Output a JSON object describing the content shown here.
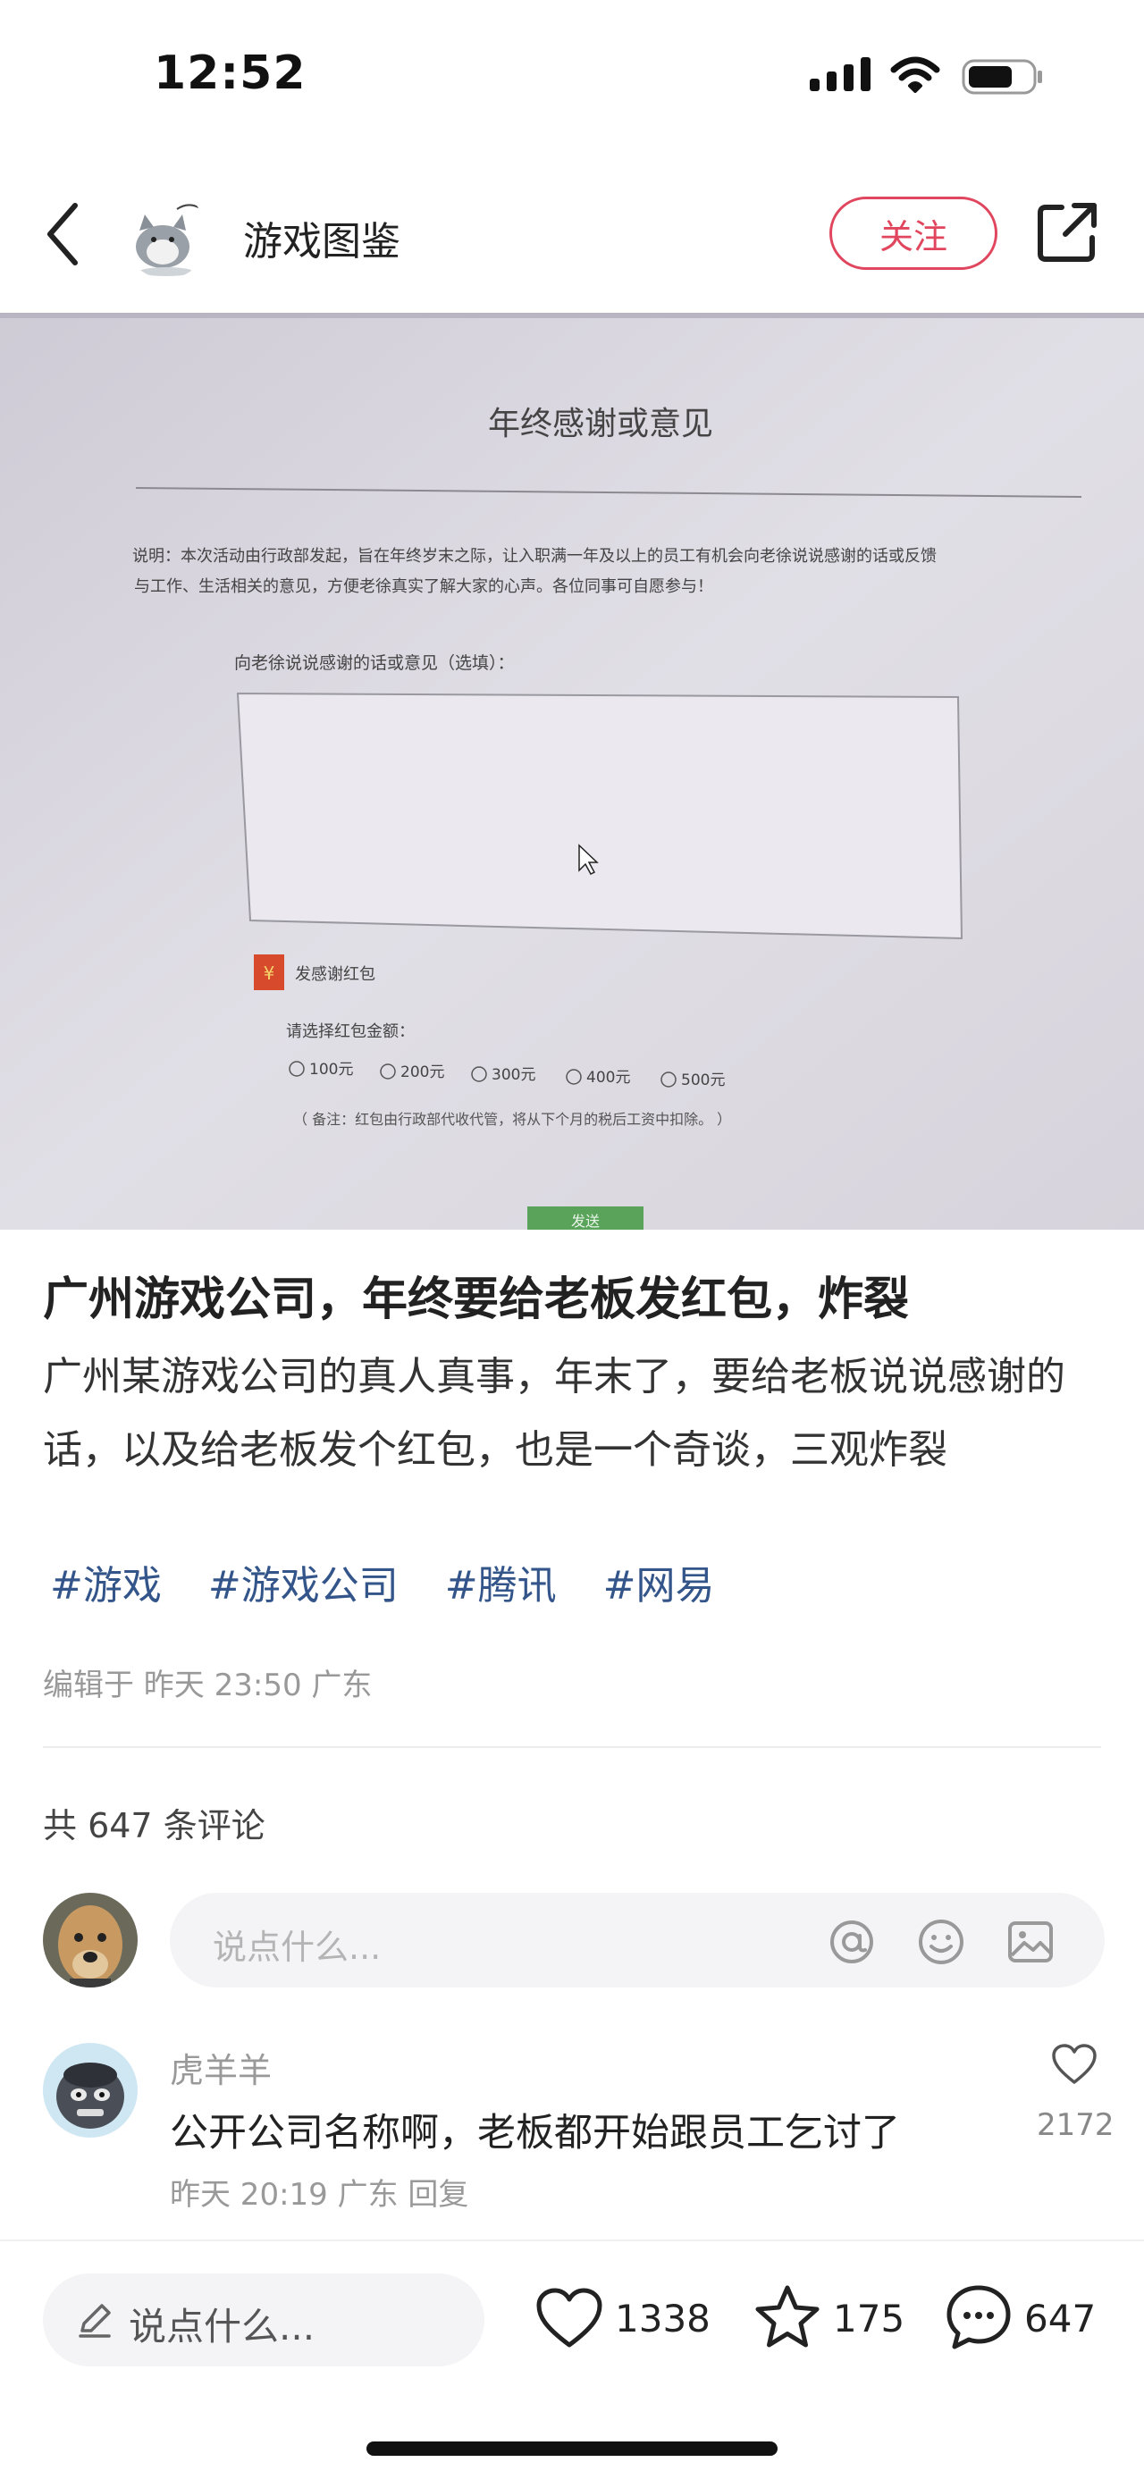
{
  "status": {
    "time": "12:52"
  },
  "nav": {
    "author": "游戏图鉴",
    "follow_label": "关注"
  },
  "photo": {
    "form_title": "年终感谢或意见",
    "desc_line1": "说明：本次活动由行政部发起，旨在年终岁末之际，让入职满一年及以上的员工有机会向老徐说说感谢的话或反馈",
    "desc_line2": "与工作、生活相关的意见，方便老徐真实了解大家的心声。各位同事可自愿参与！",
    "prompt": "向老徐说说感谢的话或意见（选填）：",
    "hongbao_icon": "¥",
    "hongbao_label": "发感谢红包",
    "amount_label": "请选择红包金额：",
    "amounts": [
      "100元",
      "200元",
      "300元",
      "400元",
      "500元"
    ],
    "note": "（ 备注：红包由行政部代收代管，将从下个月的税后工资中扣除。 ）",
    "send_label": "发送"
  },
  "post": {
    "title": "广州游戏公司，年终要给老板发红包，炸裂",
    "body": "广州某游戏公司的真人真事，年末了，要给老板说说感谢的话，以及给老板发个红包，也是一个奇谈，三观炸裂",
    "tags": [
      "#游戏",
      "#游戏公司",
      "#腾讯",
      "#网易"
    ],
    "edit_info": "编辑于 昨天 23:50 广东"
  },
  "comments": {
    "count_text": "共 647 条评论",
    "input_placeholder": "说点什么...",
    "items": [
      {
        "user": "虎羊羊",
        "text": "公开公司名称啊，老板都开始跟员工乞讨了",
        "meta": "昨天 20:19 广东 回复",
        "likes": "2172"
      }
    ]
  },
  "bottom_bar": {
    "placeholder": "说点什么...",
    "likes": "1338",
    "collects": "175",
    "comments": "647"
  }
}
